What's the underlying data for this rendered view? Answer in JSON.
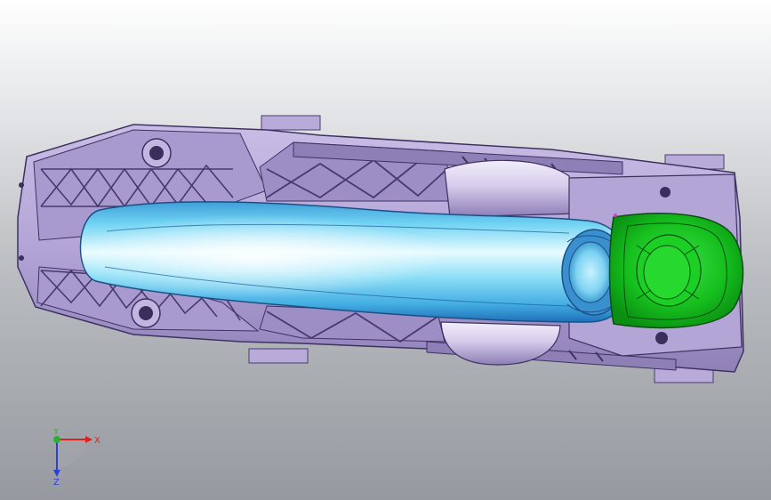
{
  "viewport": {
    "background_top": "#ffffff",
    "background_bottom": "#969aa0"
  },
  "model": {
    "housing_color": "#b7a8d8",
    "handle_color": "#57c6ee",
    "cap_color": "#13c41a"
  },
  "triad": {
    "x_label": "X",
    "y_label": "Y",
    "z_label": "Z",
    "x_color": "#e0201a",
    "y_color": "#29b030",
    "z_color": "#2f3fd6"
  }
}
